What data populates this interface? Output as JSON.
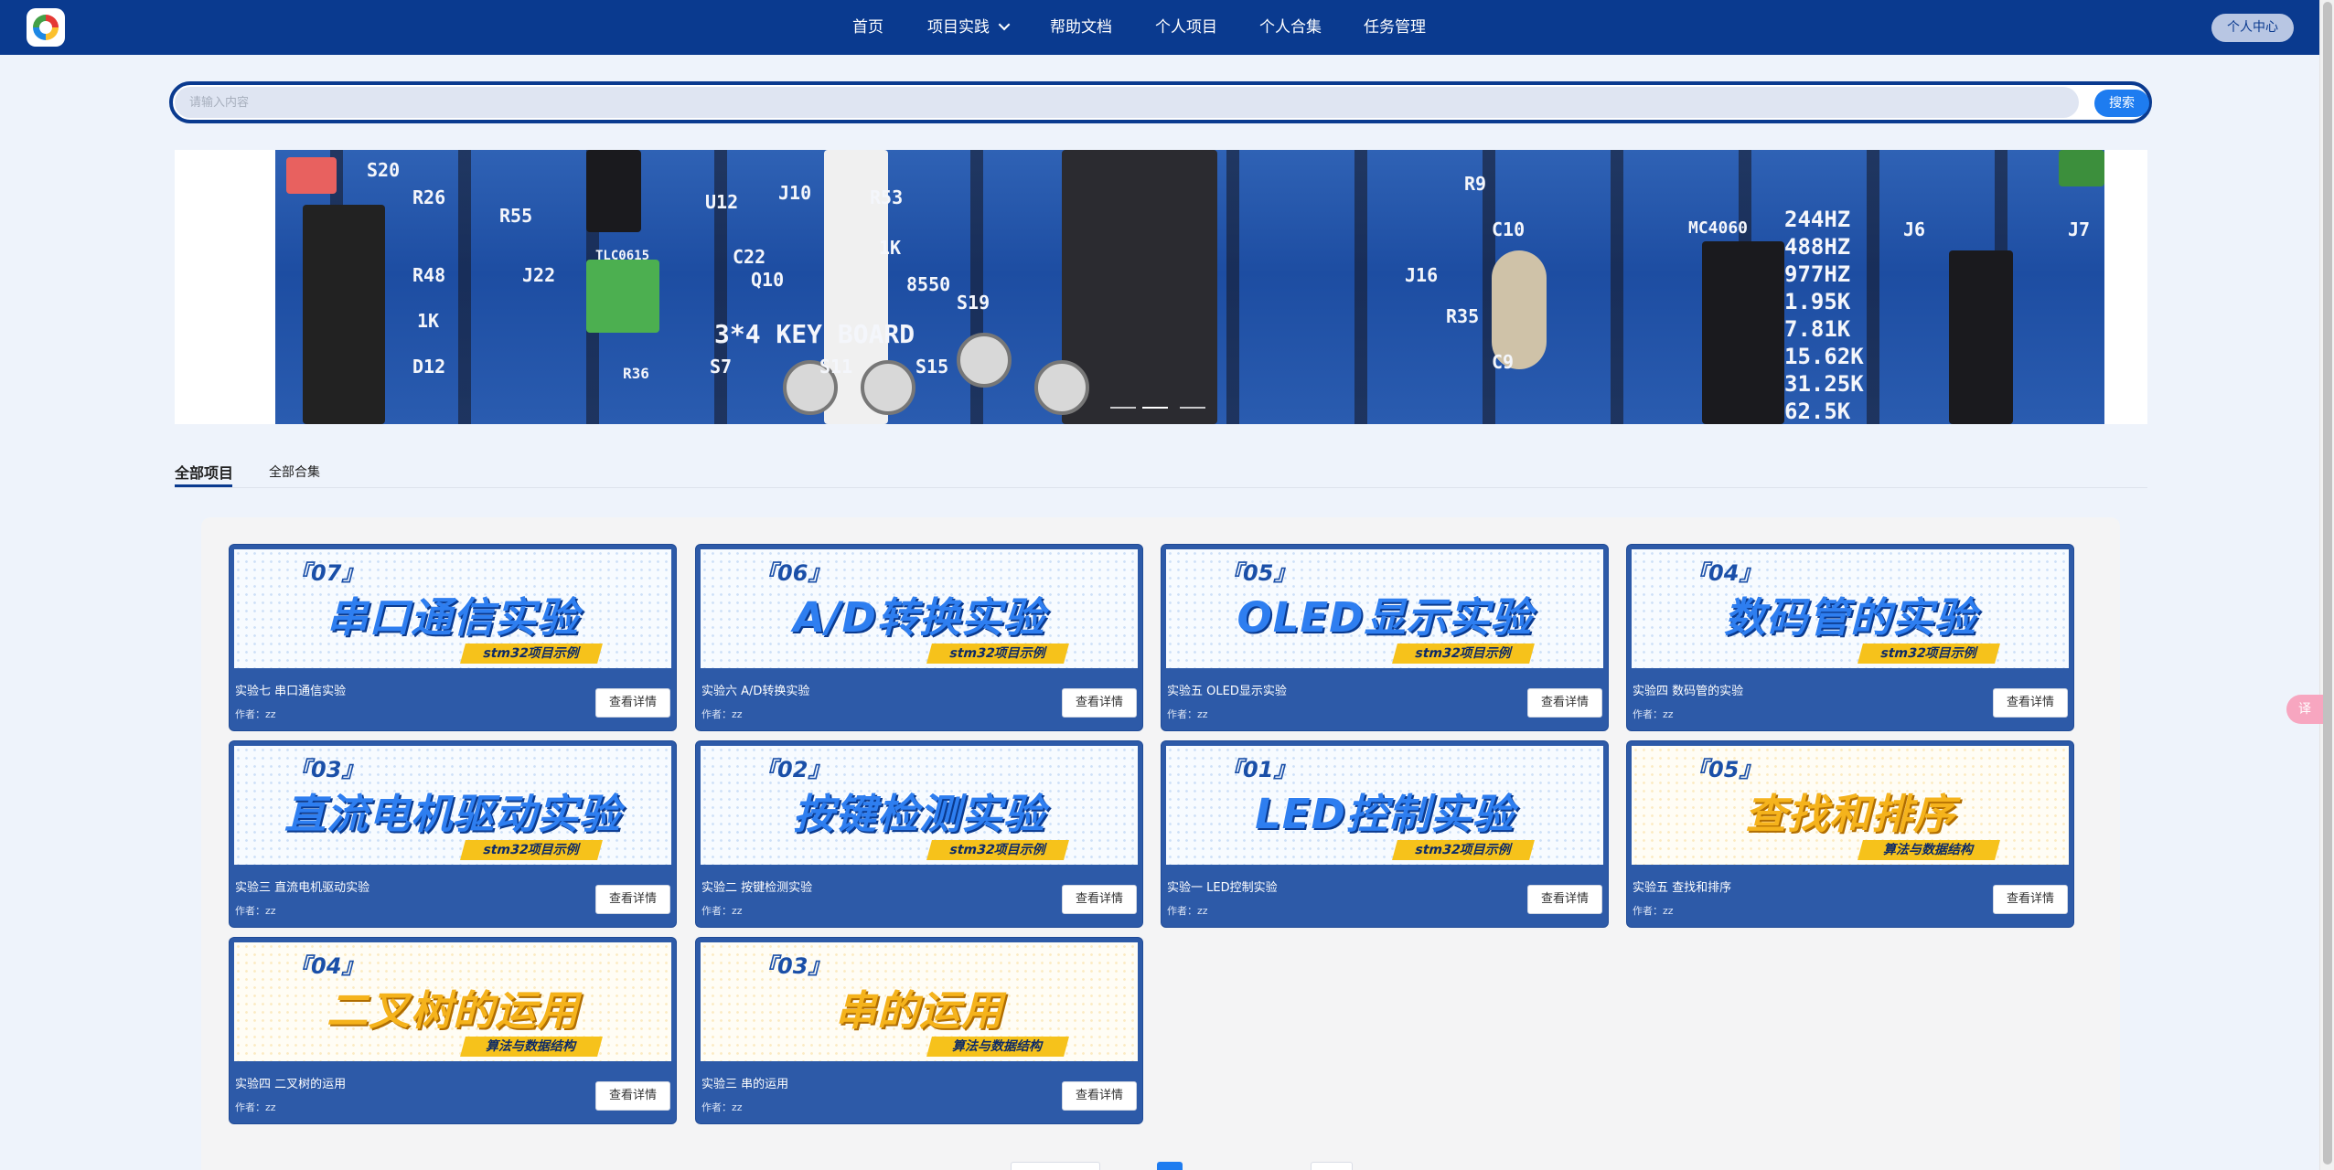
{
  "navbar": {
    "items": [
      {
        "label": "首页"
      },
      {
        "label": "项目实践",
        "dropdown": true
      },
      {
        "label": "帮助文档"
      },
      {
        "label": "个人项目"
      },
      {
        "label": "个人合集"
      },
      {
        "label": "任务管理"
      }
    ],
    "user_button": "个人中心",
    "colors": {
      "navbar": "#0a3a8f",
      "accent": "#1e7cf0"
    }
  },
  "search": {
    "placeholder": "请输入内容",
    "value": "",
    "button_label": "搜索"
  },
  "banner": {
    "image": "stm32-development-board-photo",
    "silkscreen": [
      "S20",
      "R26",
      "R55",
      "U12",
      "J10",
      "R53",
      "1K",
      "C22",
      "Q10",
      "8550",
      "S19",
      "R48",
      "1K",
      "J22",
      "TLC0615",
      "D12",
      "R36",
      "S7",
      "S11",
      "S15",
      "3*4 KEY BOARD",
      "R9",
      "C10",
      "J16",
      "R35",
      "C9",
      "MC4060",
      "244HZ",
      "488HZ",
      "977HZ",
      "1.95K",
      "7.81K",
      "15.62K",
      "31.25K",
      "62.5K",
      "J7",
      "J6"
    ],
    "slide_count": 3,
    "active_slide": 1
  },
  "tabs": [
    {
      "label": "全部项目",
      "active": true
    },
    {
      "label": "全部合集",
      "active": false
    }
  ],
  "projects": [
    {
      "number": "『07』",
      "banner_title": "串口通信实验",
      "tag": "stm32项目示例",
      "theme": "blue",
      "title": "实验七 串口通信实验",
      "author": "作者：zz",
      "button": "查看详情"
    },
    {
      "number": "『06』",
      "banner_title": "A/D转换实验",
      "tag": "stm32项目示例",
      "theme": "blue",
      "title": "实验六 A/D转换实验",
      "author": "作者：zz",
      "button": "查看详情"
    },
    {
      "number": "『05』",
      "banner_title": "OLED显示实验",
      "tag": "stm32项目示例",
      "theme": "blue",
      "title": "实验五 OLED显示实验",
      "author": "作者：zz",
      "button": "查看详情"
    },
    {
      "number": "『04』",
      "banner_title": "数码管的实验",
      "tag": "stm32项目示例",
      "theme": "blue",
      "title": "实验四 数码管的实验",
      "author": "作者：zz",
      "button": "查看详情"
    },
    {
      "number": "『03』",
      "banner_title": "直流电机驱动实验",
      "tag": "stm32项目示例",
      "theme": "blue",
      "title": "实验三 直流电机驱动实验",
      "author": "作者：zz",
      "button": "查看详情"
    },
    {
      "number": "『02』",
      "banner_title": "按键检测实验",
      "tag": "stm32项目示例",
      "theme": "blue",
      "title": "实验二 按键检测实验",
      "author": "作者：zz",
      "button": "查看详情"
    },
    {
      "number": "『01』",
      "banner_title": "LED控制实验",
      "tag": "stm32项目示例",
      "theme": "blue",
      "title": "实验一 LED控制实验",
      "author": "作者：zz",
      "button": "查看详情"
    },
    {
      "number": "『05』",
      "banner_title": "查找和排序",
      "tag": "算法与数据结构",
      "theme": "yellow",
      "title": "实验五 查找和排序",
      "author": "作者：zz",
      "button": "查看详情"
    },
    {
      "number": "『04』",
      "banner_title": "二叉树的运用",
      "tag": "算法与数据结构",
      "theme": "yellow",
      "title": "实验四 二叉树的运用",
      "author": "作者：zz",
      "button": "查看详情"
    },
    {
      "number": "『03』",
      "banner_title": "串的运用",
      "tag": "算法与数据结构",
      "theme": "yellow",
      "title": "实验三 串的运用",
      "author": "作者：zz",
      "button": "查看详情"
    }
  ],
  "floating_button": {
    "icon": "translate-icon",
    "label": "译"
  },
  "pagination": {
    "current_page": 1
  }
}
